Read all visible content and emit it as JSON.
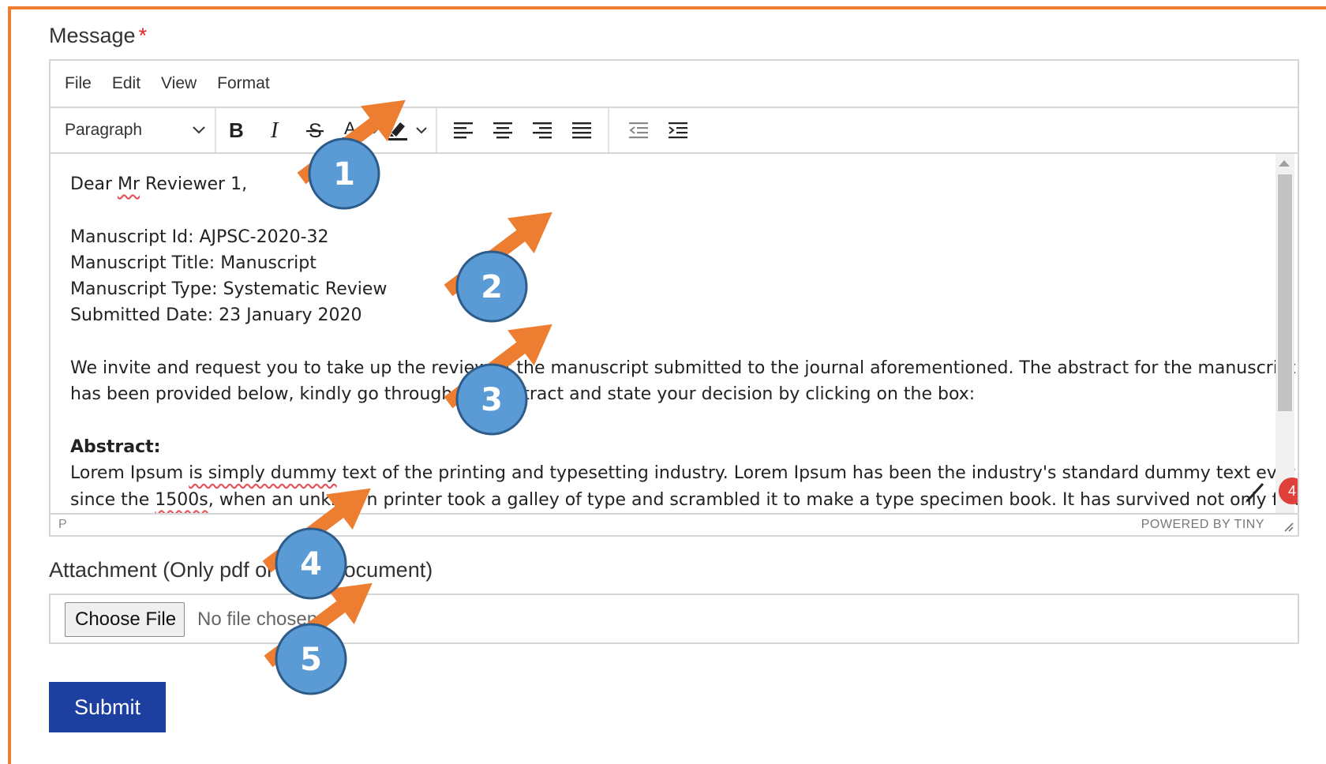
{
  "message": {
    "label": "Message",
    "required_mark": "*"
  },
  "menubar": {
    "items": [
      "File",
      "Edit",
      "View",
      "Format"
    ]
  },
  "toolbar": {
    "block_format": "Paragraph",
    "buttons": [
      "bold",
      "italic",
      "strikethrough",
      "text-color",
      "highlight",
      "align-left",
      "align-center",
      "align-right",
      "justify",
      "outdent",
      "indent"
    ]
  },
  "content": {
    "greeting_pre": "Dear ",
    "greeting_flag": "Mr",
    "greeting_post": " Reviewer 1,",
    "manuscript_id": "Manuscript Id: AJPSC-2020-32",
    "manuscript_title": "Manuscript Title: Manuscript",
    "manuscript_type": "Manuscript Type: Systematic Review",
    "submitted_date": "Submitted Date: 23 January 2020",
    "invite_line1": "We invite and request you to take up the review of the manuscript submitted to the journal aforementioned. The abstract for the manuscript",
    "invite_line2": "has been provided below, kindly go through the abstract and state your decision by clicking on the box:",
    "abstract_heading": "Abstract:",
    "abstract_l1_pre": "Lorem Ipsum ",
    "abstract_l1_flag": "is simply dummy",
    "abstract_l1_post": " text of the printing and typesetting industry. Lorem Ipsum has been the industry's standard dummy text ever",
    "abstract_l2_pre": "since the ",
    "abstract_l2_flag": "1500s",
    "abstract_l2_post": ", when an unknown printer took a galley of type and scrambled it to make a type specimen book. It has survived not only five"
  },
  "spellcheck_badge": "4",
  "statusbar": {
    "path": "P",
    "powered_by": "POWERED BY TINY"
  },
  "attachment": {
    "label": "Attachment (Only pdf or word document)",
    "button": "Choose File",
    "status": "No file chosen"
  },
  "submit_label": "Submit",
  "callouts": [
    "1",
    "2",
    "3",
    "4",
    "5"
  ],
  "colors": {
    "frame": "#ED7D31",
    "arrow": "#ED7D31",
    "callout_fill": "#5B9BD5",
    "submit_bg": "#1D3FA0",
    "required": "#E02424",
    "badge": "#E0403C"
  }
}
